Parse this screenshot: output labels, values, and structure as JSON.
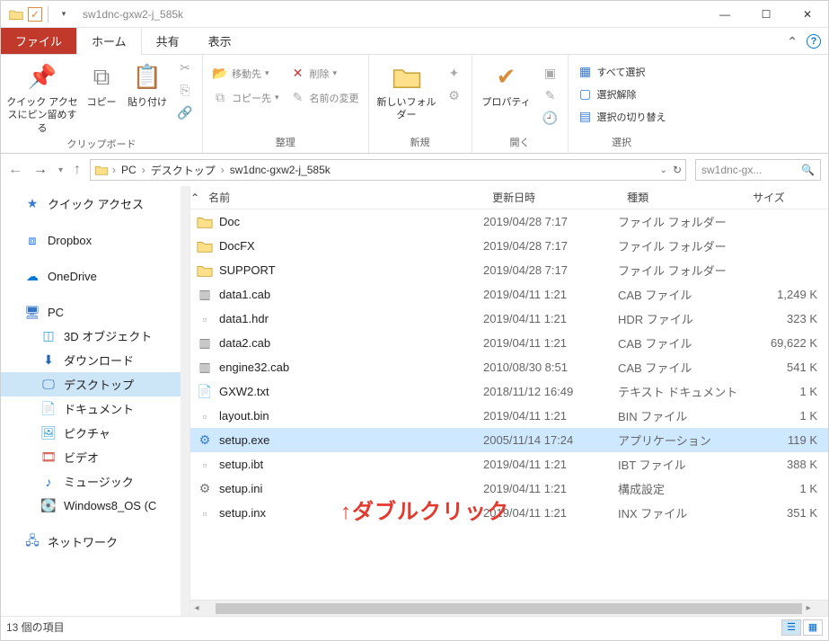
{
  "window": {
    "title": "sw1dnc-gxw2-j_585k"
  },
  "ribbon_tabs": {
    "file": "ファイル",
    "home": "ホーム",
    "share": "共有",
    "view": "表示"
  },
  "ribbon": {
    "clipboard": {
      "label": "クリップボード",
      "pin": "クイック アクセスにピン留めする",
      "copy": "コピー",
      "paste": "貼り付け"
    },
    "organize": {
      "label": "整理",
      "moveto": "移動先",
      "copyto": "コピー先",
      "delete": "削除",
      "rename": "名前の変更"
    },
    "new": {
      "label": "新規",
      "newfolder": "新しいフォルダー"
    },
    "open": {
      "label": "開く",
      "properties": "プロパティ"
    },
    "select": {
      "label": "選択",
      "all": "すべて選択",
      "none": "選択解除",
      "invert": "選択の切り替え"
    }
  },
  "addressbar": {
    "pc": "PC",
    "desktop": "デスクトップ",
    "folder": "sw1dnc-gxw2-j_585k",
    "search_placeholder": "sw1dnc-gx..."
  },
  "sidebar": {
    "quick_access": "クイック アクセス",
    "dropbox": "Dropbox",
    "onedrive": "OneDrive",
    "pc": "PC",
    "objects3d": "3D オブジェクト",
    "downloads": "ダウンロード",
    "desktop": "デスクトップ",
    "documents": "ドキュメント",
    "pictures": "ピクチャ",
    "videos": "ビデオ",
    "music": "ミュージック",
    "osdrive": "Windows8_OS (C",
    "network": "ネットワーク"
  },
  "columns": {
    "name": "名前",
    "date": "更新日時",
    "type": "種類",
    "size": "サイズ"
  },
  "files": [
    {
      "name": "Doc",
      "date": "2019/04/28 7:17",
      "type": "ファイル フォルダー",
      "size": "",
      "icon": "folder"
    },
    {
      "name": "DocFX",
      "date": "2019/04/28 7:17",
      "type": "ファイル フォルダー",
      "size": "",
      "icon": "folder"
    },
    {
      "name": "SUPPORT",
      "date": "2019/04/28 7:17",
      "type": "ファイル フォルダー",
      "size": "",
      "icon": "folder"
    },
    {
      "name": "data1.cab",
      "date": "2019/04/11 1:21",
      "type": "CAB ファイル",
      "size": "1,249 K",
      "icon": "cab"
    },
    {
      "name": "data1.hdr",
      "date": "2019/04/11 1:21",
      "type": "HDR ファイル",
      "size": "323 K",
      "icon": "file"
    },
    {
      "name": "data2.cab",
      "date": "2019/04/11 1:21",
      "type": "CAB ファイル",
      "size": "69,622 K",
      "icon": "cab"
    },
    {
      "name": "engine32.cab",
      "date": "2010/08/30 8:51",
      "type": "CAB ファイル",
      "size": "541 K",
      "icon": "cab"
    },
    {
      "name": "GXW2.txt",
      "date": "2018/11/12 16:49",
      "type": "テキスト ドキュメント",
      "size": "1 K",
      "icon": "txt"
    },
    {
      "name": "layout.bin",
      "date": "2019/04/11 1:21",
      "type": "BIN ファイル",
      "size": "1 K",
      "icon": "file"
    },
    {
      "name": "setup.exe",
      "date": "2005/11/14 17:24",
      "type": "アプリケーション",
      "size": "119 K",
      "icon": "exe",
      "selected": true
    },
    {
      "name": "setup.ibt",
      "date": "2019/04/11 1:21",
      "type": "IBT ファイル",
      "size": "388 K",
      "icon": "file"
    },
    {
      "name": "setup.ini",
      "date": "2019/04/11 1:21",
      "type": "構成設定",
      "size": "1 K",
      "icon": "ini"
    },
    {
      "name": "setup.inx",
      "date": "2019/04/11 1:21",
      "type": "INX ファイル",
      "size": "351 K",
      "icon": "file"
    }
  ],
  "statusbar": {
    "count": "13 個の項目"
  },
  "annotation": "↑ダブルクリック"
}
